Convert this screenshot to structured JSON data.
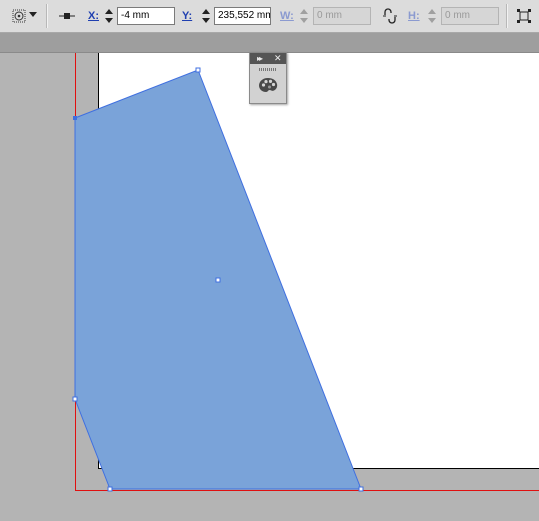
{
  "control_bar": {
    "x_label": "X:",
    "x_value": "-4 mm",
    "y_label": "Y:",
    "y_value": "235,552 mm",
    "w_label": "W:",
    "w_value": "0 mm",
    "h_label": "H:",
    "h_value": "0 mm"
  },
  "icons": {
    "reference_point": "reference-point-icon",
    "dropdown": "chevron-down-icon",
    "line_link": "link-stroke-icon",
    "constrain": "chain-link-icon",
    "transform": "transform-icon",
    "panel_expand": "double-arrow-icon",
    "panel_close": "close-icon",
    "swatches": "palette-icon"
  },
  "colors": {
    "shape_fill": "#7aa3d9",
    "selection_blue": "#3f6fe0",
    "bleed_red": "#e01010",
    "page_white": "#ffffff",
    "pasteboard": "#b4b4b4"
  }
}
